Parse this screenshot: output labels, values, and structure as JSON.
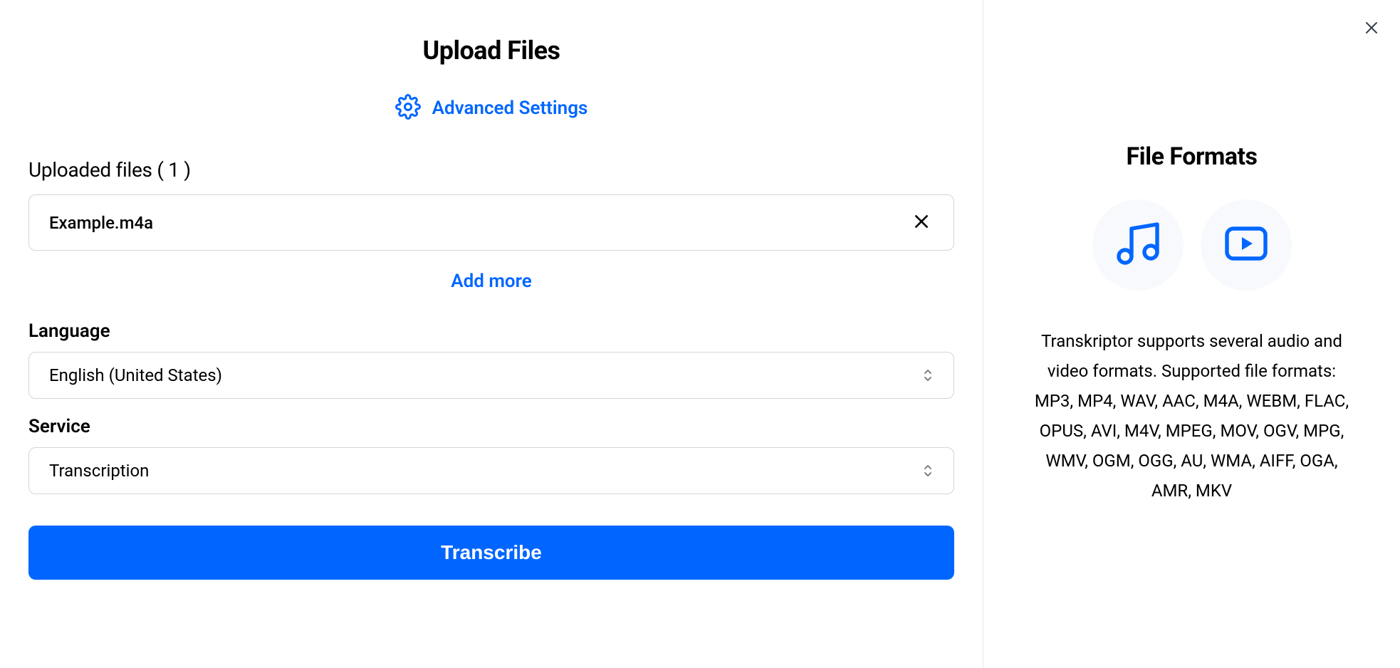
{
  "colors": {
    "primary": "#0066ff"
  },
  "header": {
    "title": "Upload Files",
    "advanced_settings_label": "Advanced Settings"
  },
  "files": {
    "section_label": "Uploaded files ( 1 )",
    "items": [
      {
        "name": "Example.m4a"
      }
    ],
    "add_more_label": "Add more"
  },
  "language": {
    "label": "Language",
    "selected": "English (United States)"
  },
  "service": {
    "label": "Service",
    "selected": "Transcription"
  },
  "action": {
    "transcribe_label": "Transcribe"
  },
  "right_panel": {
    "title": "File Formats",
    "description": "Transkriptor supports several audio and video formats. Supported file formats: MP3, MP4, WAV, AAC, M4A, WEBM, FLAC, OPUS, AVI, M4V, MPEG, MOV, OGV, MPG, WMV, OGM, OGG, AU, WMA, AIFF, OGA, AMR, MKV"
  }
}
